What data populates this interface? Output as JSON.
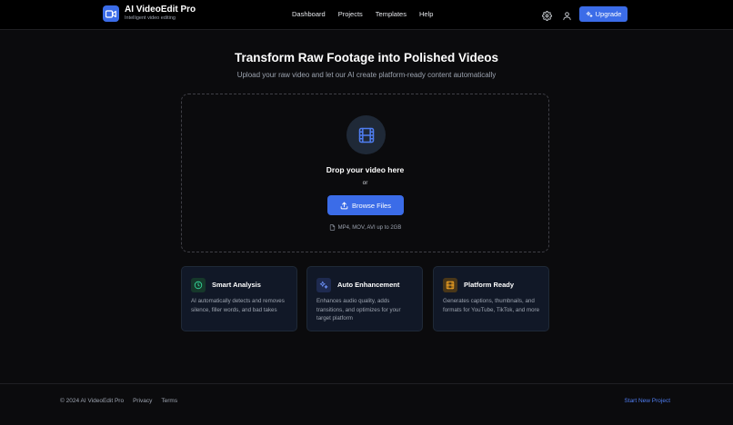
{
  "header": {
    "brand_name": "AI VideoEdit Pro",
    "brand_tagline": "Intelligent video editing",
    "nav": [
      "Dashboard",
      "Projects",
      "Templates",
      "Help"
    ],
    "settings_icon": "gear-icon",
    "user_icon": "user-icon",
    "upgrade_label": "Upgrade"
  },
  "hero": {
    "title": "Transform Raw Footage into Polished Videos",
    "subtitle": "Upload your raw video and let our AI create platform-ready content automatically"
  },
  "dropzone": {
    "icon": "film-icon",
    "title": "Drop your video here",
    "or_text": "or",
    "browse_label": "Browse Files",
    "formats": "MP4, MOV, AVI up to 2GB"
  },
  "features": [
    {
      "icon": "clock-icon",
      "title": "Smart Analysis",
      "description": "AI automatically detects and removes silence, filler words, and bad takes"
    },
    {
      "icon": "sparkles-icon",
      "title": "Auto Enhancement",
      "description": "Enhances audio quality, adds transitions, and optimizes for your target platform"
    },
    {
      "icon": "film-icon",
      "title": "Platform Ready",
      "description": "Generates captions, thumbnails, and formats for YouTube, TikTok, and more"
    }
  ],
  "footer": {
    "copyright": "© 2024 AI VideoEdit Pro",
    "links": [
      "Privacy",
      "Terms"
    ],
    "cta": "Start New Project"
  },
  "colors": {
    "accent": "#3b6ce8",
    "background": "#0b0b0d",
    "card_background": "#111827",
    "analysis_icon_bg": "#16382b",
    "enhancement_icon_bg": "#1e2a4f",
    "platform_icon_bg": "#4a3718"
  }
}
